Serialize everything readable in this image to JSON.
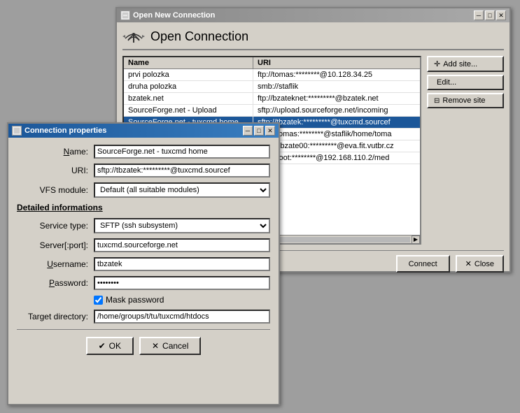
{
  "mainWindow": {
    "title": "Open New Connection",
    "headerTitle": "Open Connection",
    "controls": {
      "minimize": "─",
      "maximize": "□",
      "close": "✕"
    },
    "table": {
      "columns": [
        "Name",
        "URI"
      ],
      "rows": [
        {
          "name": "prvi polozka",
          "uri": "ftp://tomas:********@10.128.34.25"
        },
        {
          "name": "druha polozka",
          "uri": "smb://staflik"
        },
        {
          "name": "bzatek.net",
          "uri": "ftp://bzateknet:*********@bzatek.net"
        },
        {
          "name": "SourceForge.net - Upload",
          "uri": "sftp://upload.sourceforge.net/incoming"
        },
        {
          "name": "SourceForge.net - tuxcmd home",
          "uri": "sftp://tbzatek:*********@tuxcmd.sourcef",
          "selected": true
        },
        {
          "name": "",
          "uri": "sftp://tomas:********@staflik/home/toma"
        },
        {
          "name": "",
          "uri": "sftp://xbzate00:*********@eva.fit.vutbr.cz"
        },
        {
          "name": "",
          "uri": "sftp://root:********@192.168.110.2/med"
        }
      ]
    },
    "buttons": {
      "addSite": "Add site...",
      "edit": "Edit...",
      "removeSite": "Remove site"
    },
    "bottomButtons": {
      "connect": "Connect",
      "close": "Close"
    }
  },
  "dialog": {
    "title": "Connection properties",
    "controls": {
      "minimize": "─",
      "maximize": "□",
      "close": "✕"
    },
    "fields": {
      "nameLabel": "Name:",
      "nameValue": "SourceForge.net - tuxcmd home",
      "uriLabel": "URI:",
      "uriValue": "sftp://tbzatek:*********@tuxcmd.sourcef",
      "vfsLabel": "VFS module:",
      "vfsValue": "Default (all suitable modules)"
    },
    "detailedSection": "Detailed informations",
    "detailedFields": {
      "serviceTypeLabel": "Service type:",
      "serviceTypeValue": "SFTP (ssh subsystem)",
      "serverLabel": "Server[:port]:",
      "serverValue": "tuxcmd.sourceforge.net",
      "usernameLabel": "Username:",
      "usernameValue": "tbzatek",
      "passwordLabel": "Password:",
      "passwordValue": "•••••••••",
      "maskPasswordLabel": "Mask password",
      "maskPasswordChecked": true,
      "targetDirLabel": "Target directory:",
      "targetDirValue": "/home/groups/t/tu/tuxcmd/htdocs"
    },
    "buttons": {
      "ok": "OK",
      "cancel": "Cancel"
    }
  }
}
